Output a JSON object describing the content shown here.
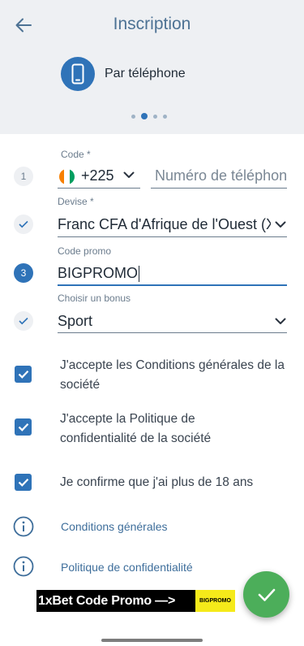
{
  "header": {
    "title": "Inscription"
  },
  "method": {
    "label": "Par téléphone",
    "icon": "smartphone-icon"
  },
  "carousel": {
    "count": 4,
    "active": 1
  },
  "form": {
    "step1": {
      "number": "1",
      "code_label": "Code *",
      "country_code": "+225",
      "flag": "cote-divoire-flag",
      "phone_placeholder": "Numéro de téléphone"
    },
    "currency": {
      "label": "Devise *",
      "value": "Franc CFA d'Afrique de l'Ouest (XOF)"
    },
    "promo": {
      "number": "3",
      "label": "Code promo",
      "value": "BIGPROMO"
    },
    "bonus": {
      "label": "Choisir un bonus",
      "value": "Sport"
    }
  },
  "checkboxes": [
    {
      "label": "J'accepte les Conditions générales de la société",
      "checked": true
    },
    {
      "label": "J'accepte la Politique de confidentialité de la société",
      "checked": true
    },
    {
      "label": "Je confirme que j'ai plus de 18 ans",
      "checked": true
    }
  ],
  "links": [
    {
      "label": "Conditions générales",
      "icon": "info-icon"
    },
    {
      "label": "Politique de confidentialité",
      "icon": "info-icon"
    }
  ],
  "banner": {
    "text": "1xBet Code Promo —>",
    "code": "BIGPROMO"
  },
  "colors": {
    "accent": "#2f73b8",
    "success": "#4cae5a",
    "title": "#4d7294",
    "background": "#eef0f3"
  }
}
